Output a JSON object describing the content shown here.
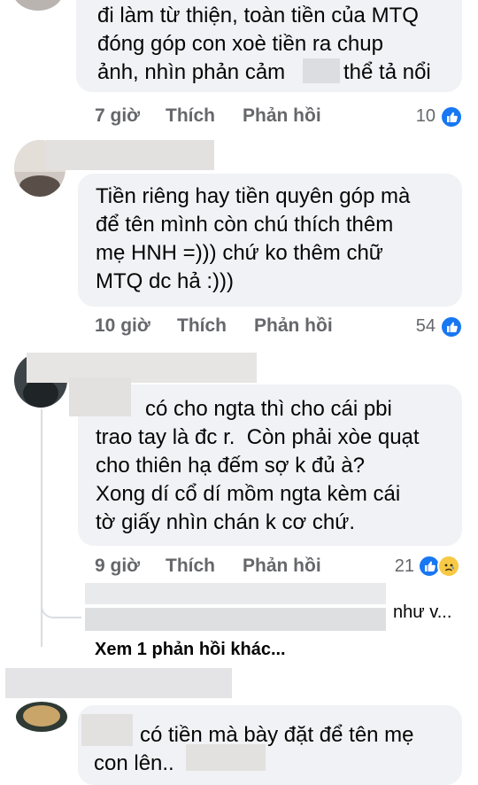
{
  "comments": [
    {
      "lines": [
        "đi làm từ thiện, toàn tiền của MTQ",
        "đóng góp con xoè tiền ra chup",
        "ảnh, nhìn phản cảm",
        "thể tả nổi"
      ],
      "time": "7 giờ",
      "like": "Thích",
      "reply": "Phản hồi",
      "reactions": "10"
    },
    {
      "lines": [
        "Tiền riêng hay tiền quyên góp mà",
        "để tên mình còn chú thích thêm",
        "mẹ HNH =))) chứ ko thêm chữ",
        "MTQ dc hả :)))"
      ],
      "time": "10 giờ",
      "like": "Thích",
      "reply": "Phản hồi",
      "reactions": "54"
    },
    {
      "lines": [
        "có cho ngta thì cho cái pbi",
        "trao tay là đc r.  Còn phải xòe quạt",
        "cho thiên hạ đếm sợ k đủ à?",
        "Xong dí cổ dí mồm ngta kèm cái",
        "tờ giấy nhìn chán k cơ chứ."
      ],
      "time": "9 giờ",
      "like": "Thích",
      "reply": "Phản hồi",
      "reactions": "21"
    },
    {
      "lines": [
        "có tiền mà bày đặt để tên mẹ",
        "con lên.."
      ]
    }
  ],
  "reply_preview": "như v...",
  "view_more": "Xem 1 phản hồi khác...",
  "colors": {
    "like": "#1877f2",
    "sad": "#f7c944",
    "meta": "#65676b",
    "bubble": "#f0f2f5"
  },
  "icons": [
    "like-reaction-icon",
    "sad-reaction-icon"
  ]
}
